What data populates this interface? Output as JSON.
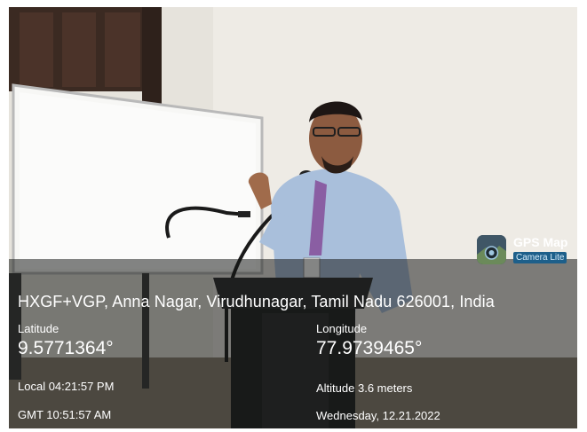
{
  "stamp": {
    "address": "HXGF+VGP, Anna Nagar, Virudhunagar, Tamil Nadu 626001, India",
    "latitude_label": "Latitude",
    "latitude_value": "9.5771364°",
    "longitude_label": "Longitude",
    "longitude_value": "77.9739465°",
    "local_time": "Local 04:21:57 PM",
    "gmt_time": "GMT 10:51:57 AM",
    "altitude": "Altitude 3.6 meters",
    "date": "Wednesday, 12.21.2022"
  },
  "badge": {
    "title": "GPS Map",
    "subtitle": "Camera Lite",
    "icon": "gps-map-camera-app-icon"
  },
  "colors": {
    "overlay": "#141614",
    "wall": "#e9e6df",
    "shirt": "#9fb8d6",
    "podium": "#1e1f20",
    "badge_sub": "#1d5f8a"
  }
}
